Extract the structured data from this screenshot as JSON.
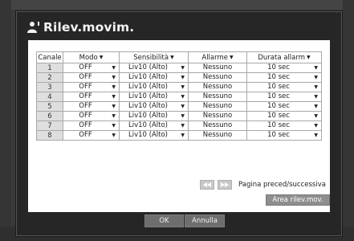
{
  "title": "Rilev.movim.",
  "icons": {
    "title": "person-motion-icon",
    "dropdown": "caret-down-icon",
    "prev": "rewind-icon",
    "next": "fast-forward-icon"
  },
  "table": {
    "headers": {
      "channel": "Canale",
      "mode": "Modo",
      "sensitivity": "Sensibilità",
      "alarm": "Allarme",
      "duration": "Durata allarm"
    },
    "rows": [
      {
        "channel": "1",
        "mode": "OFF",
        "sensitivity": "Liv10 (Alto)",
        "alarm": "Nessuno",
        "duration": "10 sec"
      },
      {
        "channel": "2",
        "mode": "OFF",
        "sensitivity": "Liv10 (Alto)",
        "alarm": "Nessuno",
        "duration": "10 sec"
      },
      {
        "channel": "3",
        "mode": "OFF",
        "sensitivity": "Liv10 (Alto)",
        "alarm": "Nessuno",
        "duration": "10 sec"
      },
      {
        "channel": "4",
        "mode": "OFF",
        "sensitivity": "Liv10 (Alto)",
        "alarm": "Nessuno",
        "duration": "10 sec"
      },
      {
        "channel": "5",
        "mode": "OFF",
        "sensitivity": "Liv10 (Alto)",
        "alarm": "Nessuno",
        "duration": "10 sec"
      },
      {
        "channel": "6",
        "mode": "OFF",
        "sensitivity": "Liv10 (Alto)",
        "alarm": "Nessuno",
        "duration": "10 sec"
      },
      {
        "channel": "7",
        "mode": "OFF",
        "sensitivity": "Liv10 (Alto)",
        "alarm": "Nessuno",
        "duration": "10 sec"
      },
      {
        "channel": "8",
        "mode": "OFF",
        "sensitivity": "Liv10 (Alto)",
        "alarm": "Nessuno",
        "duration": "10 sec"
      }
    ]
  },
  "pager": {
    "label": "Pagina preced/successiva"
  },
  "area_button": "Area rilev.mov.",
  "footer": {
    "ok": "OK",
    "cancel": "Annulla"
  },
  "colors": {
    "background": "#3a3a3a",
    "dialog": "#262626",
    "panel": "#ffffff",
    "grid_line": "#a8a8a8",
    "channel_cell": "#dedede",
    "button_gray": "#8e8e8e"
  }
}
